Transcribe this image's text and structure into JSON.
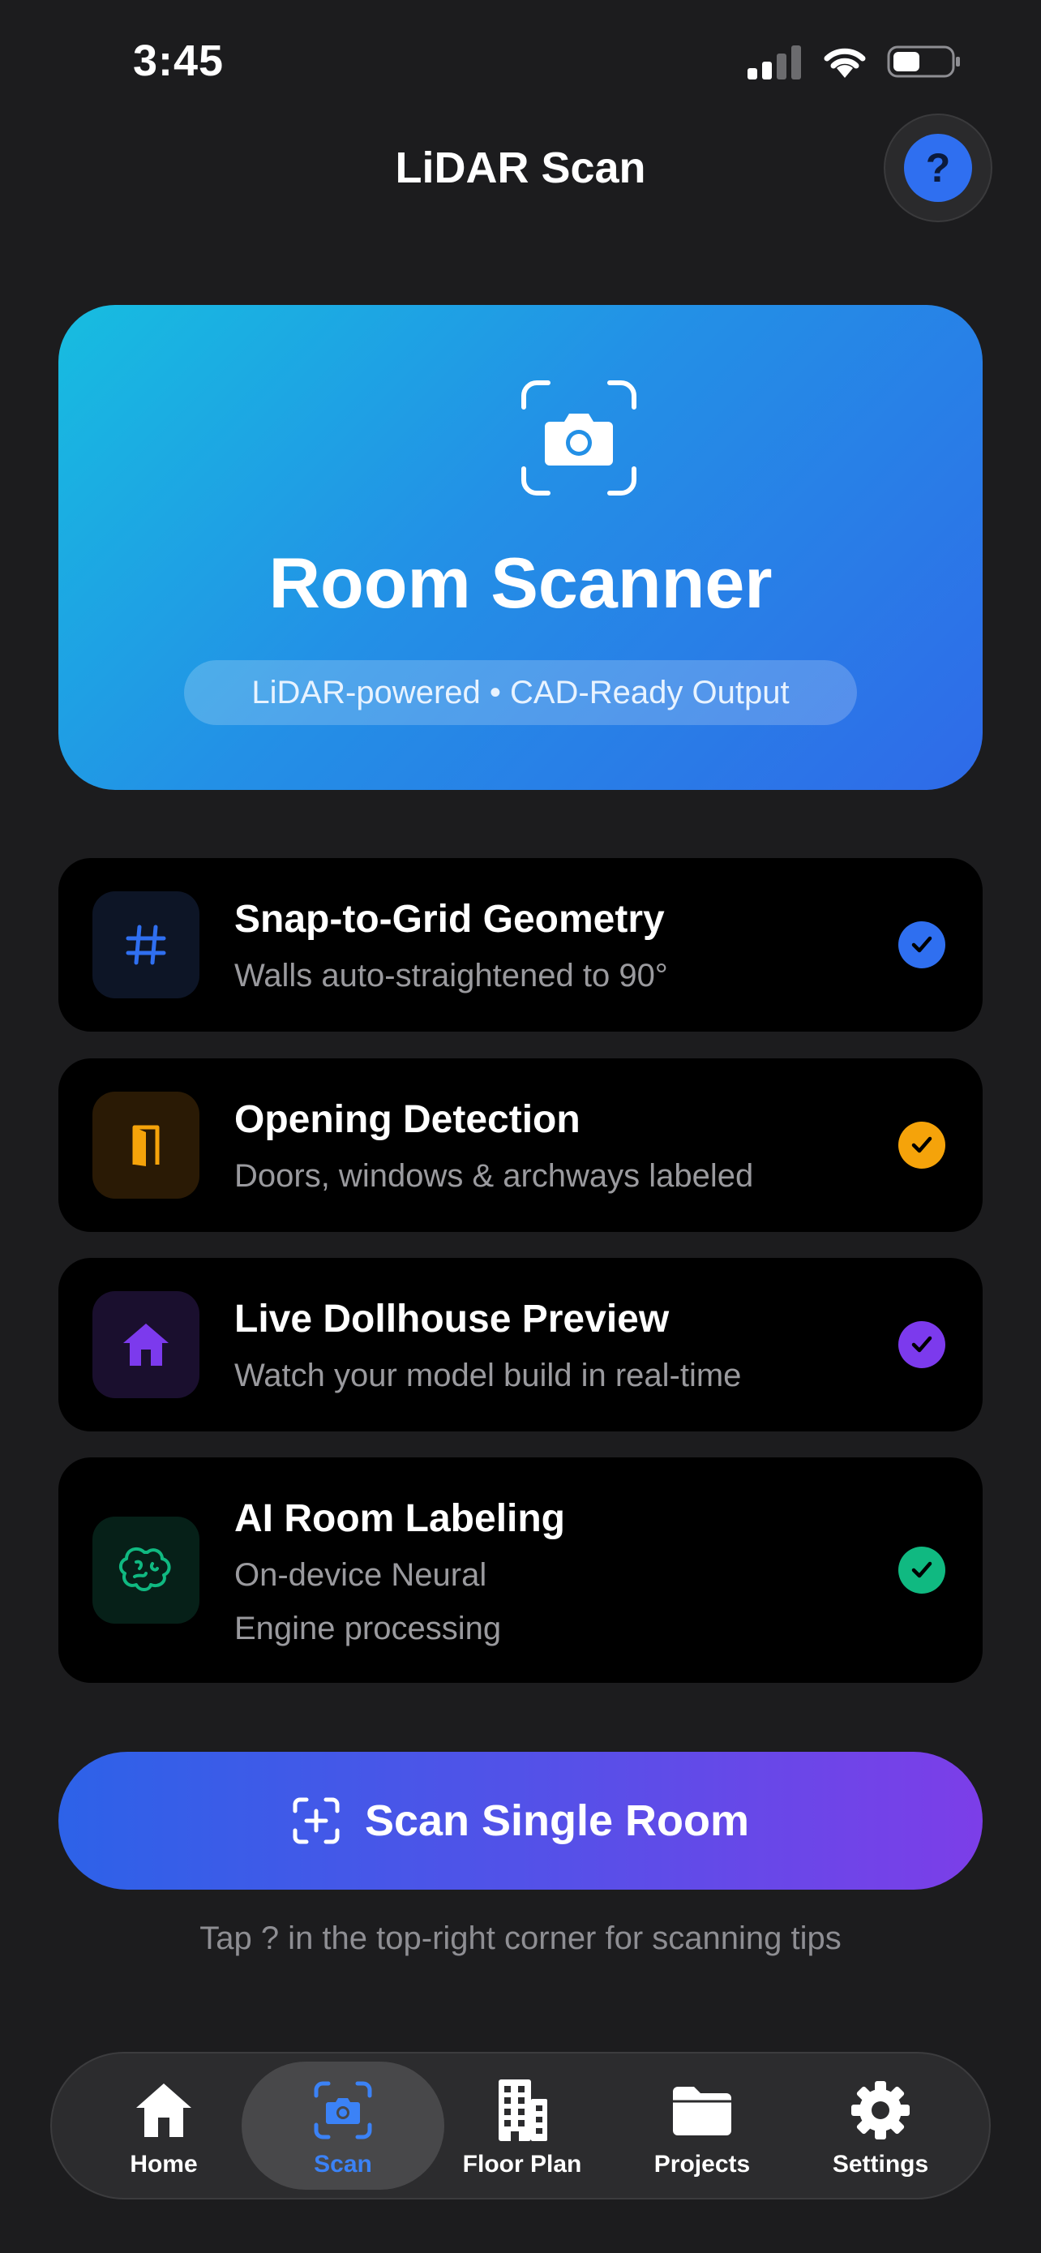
{
  "status_bar": {
    "time": "3:45"
  },
  "header": {
    "title": "LiDAR Scan",
    "help_label": "?"
  },
  "hero": {
    "title": "Room Scanner",
    "subtitle": "LiDAR-powered • CAD-Ready Output",
    "icon": "camera-viewfinder-icon"
  },
  "features": [
    {
      "title": "Snap-to-Grid Geometry",
      "subtitle": "Walls auto-straightened to 90°",
      "icon": "grid-icon",
      "accent": "#2f6ff0",
      "enabled": true
    },
    {
      "title": "Opening Detection",
      "subtitle": "Doors, windows & archways labeled",
      "icon": "door-icon",
      "accent": "#f5a30a",
      "enabled": true
    },
    {
      "title": "Live Dollhouse Preview",
      "subtitle": "Watch your model build in real-time",
      "icon": "house-icon",
      "accent": "#7c3aed",
      "enabled": true
    },
    {
      "title": "AI Room Labeling",
      "subtitle_line1": "On-device Neural",
      "subtitle_line2": "Engine processing",
      "icon": "brain-icon",
      "accent": "#10b981",
      "enabled": true
    }
  ],
  "scan_button": {
    "label": "Scan Single Room",
    "icon": "scan-plus-icon"
  },
  "hint": "Tap ? in the top-right corner for scanning tips",
  "tabs": [
    {
      "label": "Home",
      "icon": "house-icon",
      "active": false
    },
    {
      "label": "Scan",
      "icon": "camera-viewfinder-icon",
      "active": true
    },
    {
      "label": "Floor Plan",
      "icon": "building-icon",
      "active": false
    },
    {
      "label": "Projects",
      "icon": "folder-icon",
      "active": false
    },
    {
      "label": "Settings",
      "icon": "gear-icon",
      "active": false
    }
  ],
  "colors": {
    "active_tab": "#3b82f6",
    "hero_start": "#17bde0",
    "hero_end": "#2f6ae8"
  }
}
